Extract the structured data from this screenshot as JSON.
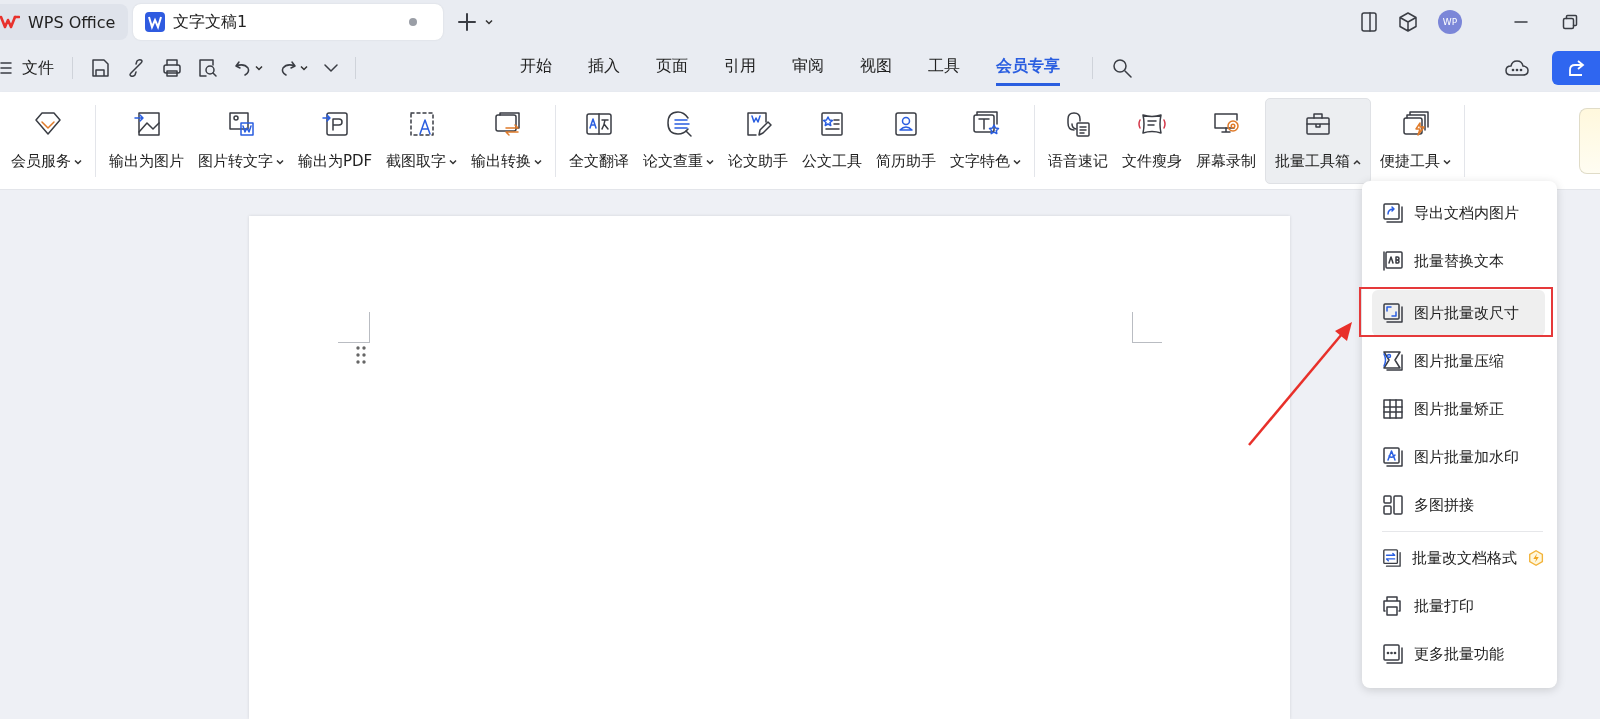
{
  "tabs": [
    {
      "kind": "home",
      "label": "WPS Office",
      "selected": false
    },
    {
      "kind": "document",
      "label": "文字文稿1",
      "selected": true,
      "modified": true
    }
  ],
  "account": {
    "avatar": "WP"
  },
  "quick_access": {
    "file_menu": "文件"
  },
  "menu_tabs": [
    {
      "label": "开始",
      "selected": false
    },
    {
      "label": "插入",
      "selected": false
    },
    {
      "label": "页面",
      "selected": false
    },
    {
      "label": "引用",
      "selected": false
    },
    {
      "label": "审阅",
      "selected": false
    },
    {
      "label": "视图",
      "selected": false
    },
    {
      "label": "工具",
      "selected": false
    },
    {
      "label": "会员专享",
      "selected": true
    }
  ],
  "ribbon": {
    "groups": [
      [
        {
          "label": "会员服务",
          "dropdown": true,
          "expanded": false
        }
      ],
      [
        {
          "label": "输出为图片",
          "dropdown": false,
          "expanded": false
        },
        {
          "label": "图片转文字",
          "dropdown": true,
          "expanded": false
        },
        {
          "label": "输出为PDF",
          "dropdown": false,
          "expanded": false
        },
        {
          "label": "截图取字",
          "dropdown": true,
          "expanded": false
        },
        {
          "label": "输出转换",
          "dropdown": true,
          "expanded": false
        }
      ],
      [
        {
          "label": "全文翻译",
          "dropdown": false,
          "expanded": false
        },
        {
          "label": "论文查重",
          "dropdown": true,
          "expanded": false
        },
        {
          "label": "论文助手",
          "dropdown": false,
          "expanded": false
        },
        {
          "label": "公文工具",
          "dropdown": false,
          "expanded": false
        },
        {
          "label": "简历助手",
          "dropdown": false,
          "expanded": false
        },
        {
          "label": "文字特色",
          "dropdown": true,
          "expanded": false
        }
      ],
      [
        {
          "label": "语音速记",
          "dropdown": false,
          "expanded": false
        },
        {
          "label": "文件瘦身",
          "dropdown": false,
          "expanded": false
        },
        {
          "label": "屏幕录制",
          "dropdown": false,
          "expanded": false
        },
        {
          "label": "批量工具箱",
          "dropdown": true,
          "expanded": true
        },
        {
          "label": "便捷工具",
          "dropdown": true,
          "expanded": false
        }
      ]
    ]
  },
  "dropdown": {
    "sections": [
      [
        {
          "label": "导出文档内图片",
          "highlighted": false,
          "annotated": false,
          "premium": false
        },
        {
          "label": "批量替换文本",
          "highlighted": false,
          "annotated": false,
          "premium": false
        }
      ],
      [
        {
          "label": "图片批量改尺寸",
          "highlighted": true,
          "annotated": true,
          "premium": false
        },
        {
          "label": "图片批量压缩",
          "highlighted": false,
          "annotated": false,
          "premium": false
        },
        {
          "label": "图片批量矫正",
          "highlighted": false,
          "annotated": false,
          "premium": false
        },
        {
          "label": "图片批量加水印",
          "highlighted": false,
          "annotated": false,
          "premium": false
        },
        {
          "label": "多图拼接",
          "highlighted": false,
          "annotated": false,
          "premium": false
        }
      ],
      [
        {
          "label": "批量改文档格式",
          "highlighted": false,
          "annotated": false,
          "premium": true
        },
        {
          "label": "批量打印",
          "highlighted": false,
          "annotated": false,
          "premium": false
        },
        {
          "label": "更多批量功能",
          "highlighted": false,
          "annotated": false,
          "premium": false
        }
      ]
    ]
  }
}
